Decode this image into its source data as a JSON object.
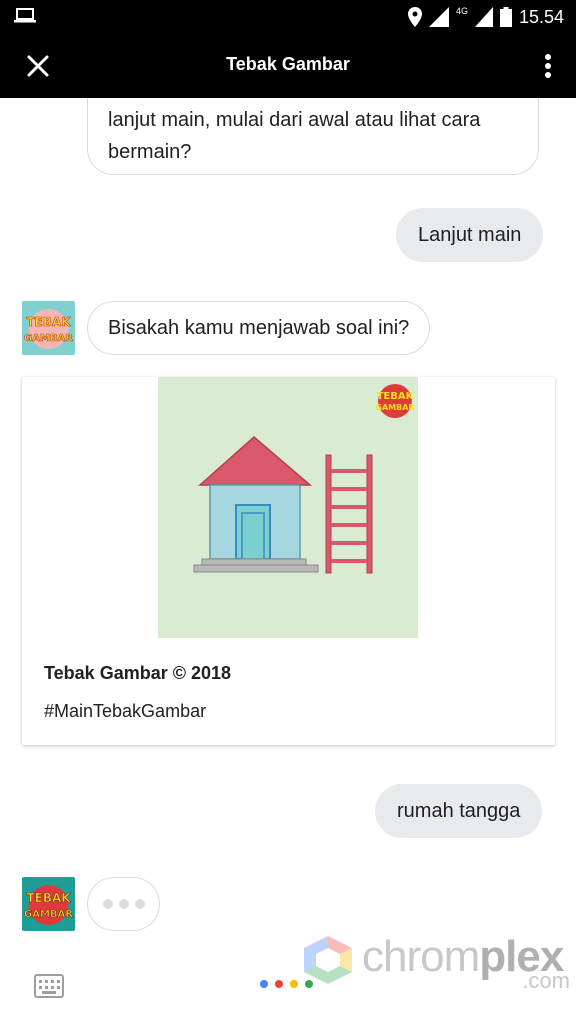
{
  "status_bar": {
    "time": "15.54",
    "network": "4G"
  },
  "app_bar": {
    "title": "Tebak Gambar"
  },
  "messages": {
    "bot_prev": "lanjut main, mulai dari awal atau lihat cara bermain?",
    "user_1": "Lanjut main",
    "bot_question": "Bisakah kamu menjawab soal ini?",
    "user_2": "rumah tangga"
  },
  "avatar": {
    "line1": "TEBAK",
    "line2": "GAMBAR"
  },
  "card": {
    "title": "Tebak Gambar © 2018",
    "subtitle": "#MainTebakGambar",
    "logo_line1": "TEBAK",
    "logo_line2": "GAMBAR"
  },
  "watermark": {
    "word_light": "chrom",
    "word_bold": "plex",
    "domain": ".com"
  },
  "colors": {
    "bar_bg": "#000000",
    "user_bubble": "#e8eaed",
    "bubble_border": "#dadce0",
    "card_image_bg": "#d9ebd3",
    "roof": "#d9596a",
    "house_wall": "#a6d6df",
    "ladder": "#d9596a"
  },
  "icons": {
    "close": "close-icon",
    "more": "more-vert-icon",
    "keyboard": "keyboard-icon",
    "location": "location-icon",
    "battery": "battery-icon"
  }
}
